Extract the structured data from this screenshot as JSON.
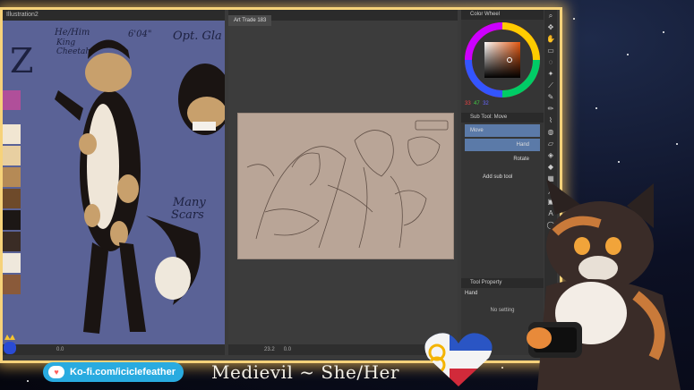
{
  "reference_panel": {
    "tab_label": "Illustration2",
    "texts": [
      "He/Him",
      "King",
      "Cheetah",
      "6'04\"",
      "Opt. Gla",
      "Many",
      "Scars"
    ],
    "bottom_zoom": "0.0"
  },
  "canvas": {
    "tab_label": "Art Trade 183",
    "bottom_zoom": "23.2",
    "bottom_angle": "0.0"
  },
  "color_wheel": {
    "title": "Color Wheel",
    "values": [
      "33",
      "47",
      "32"
    ],
    "current_color": "#c98a6a"
  },
  "sub_tool": {
    "title": "Sub Tool: Move",
    "items": [
      {
        "label": "Move",
        "selected": true
      },
      {
        "label": "Hand",
        "selected": true
      },
      {
        "label": "Rotate",
        "selected": false
      }
    ],
    "add_label": "Add sub tool"
  },
  "tool_property": {
    "title": "Tool Property",
    "tool_name": "Hand",
    "empty_text": "No setting"
  },
  "stream": {
    "kofi_text": "Ko-fi.com/iciclefeather",
    "streamer_name": "Medievil ~ She/Her"
  },
  "colors": {
    "frame_glow": "#f6d27a",
    "kofi_blue": "#29abe0",
    "ref_bg": "#5a6296",
    "sketch_bg": "#b9a597"
  }
}
